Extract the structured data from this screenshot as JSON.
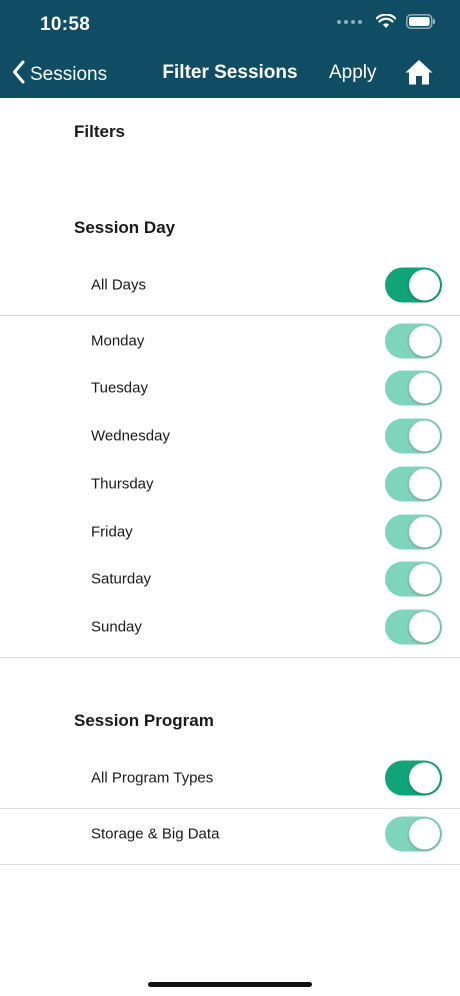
{
  "status": {
    "time": "10:58"
  },
  "nav": {
    "back_label": "Sessions",
    "title": "Filter Sessions",
    "apply_label": "Apply"
  },
  "filters_heading": "Filters",
  "session_day": {
    "heading": "Session Day",
    "all_label": "All Days",
    "all_on": true,
    "days": [
      {
        "label": "Monday",
        "on": true
      },
      {
        "label": "Tuesday",
        "on": true
      },
      {
        "label": "Wednesday",
        "on": true
      },
      {
        "label": "Thursday",
        "on": true
      },
      {
        "label": "Friday",
        "on": true
      },
      {
        "label": "Saturday",
        "on": true
      },
      {
        "label": "Sunday",
        "on": true
      }
    ]
  },
  "session_program": {
    "heading": "Session Program",
    "all_label": "All Program Types",
    "all_on": true,
    "programs": [
      {
        "label": "Storage & Big Data",
        "on": true
      }
    ]
  },
  "colors": {
    "header_bg": "#0e4d63",
    "toggle_active": "#10a579",
    "toggle_muted": "#7fd4bc"
  }
}
